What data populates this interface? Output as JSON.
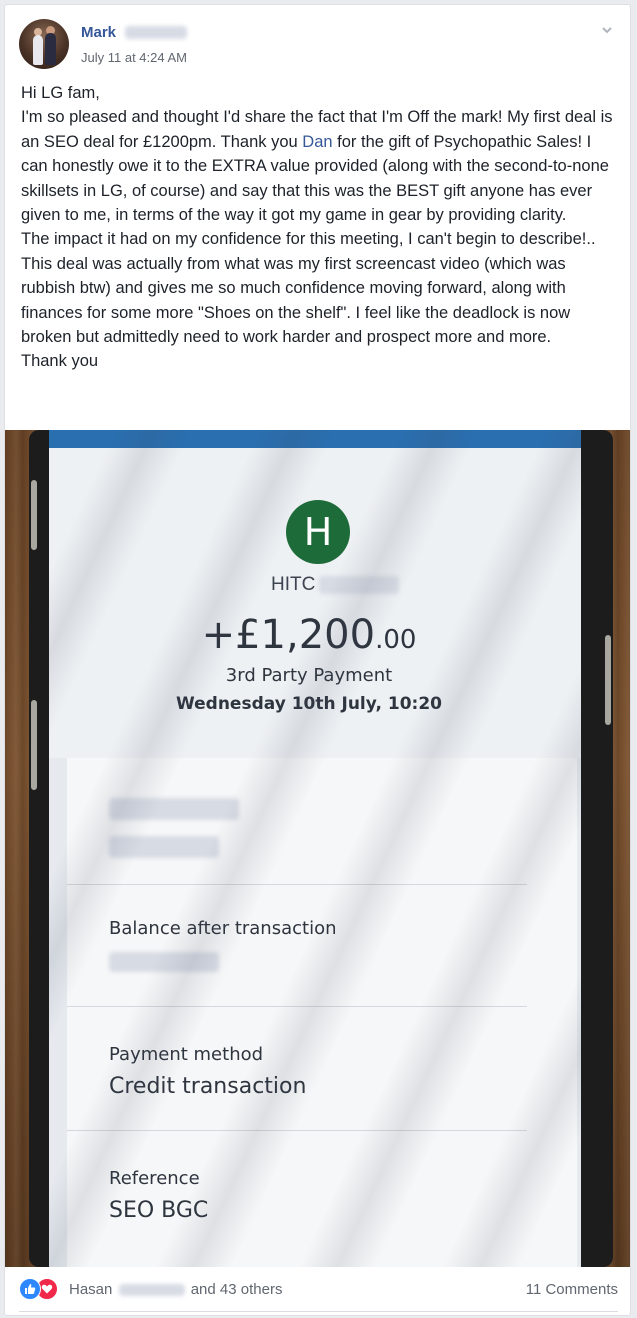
{
  "post": {
    "author_first_name": "Mark",
    "timestamp": "July 11 at 4:24 AM",
    "body": {
      "p1": "Hi LG fam,",
      "p2_before_mention": "I'm so pleased and thought I'd share the fact that I'm Off the mark! My first deal is an SEO deal for £1200pm. Thank you ",
      "p2_mention": "Dan",
      "p2_after_mention": " for the gift of Psychopathic Sales! I can honestly owe it to the EXTRA value provided (along with the second-to-none skillsets in LG, of course) and say that this was the BEST gift anyone has ever given to me, in terms of the way it got my game in gear by providing clarity.",
      "p3": "The impact it had on my confidence for this meeting, I can't begin to describe!.. This deal was actually from what was my first screencast video (which was rubbish btw) and gives me so much confidence moving forward, along with finances for some more \"Shoes on the shelf\". I feel like the deadlock is now broken but admittedly need to work harder and prospect more and more.",
      "p4": "Thank you"
    }
  },
  "bank_screen": {
    "logo_letter": "H",
    "payee_visible": "HITC",
    "amount_main": "+£1,200",
    "amount_pence": ".00",
    "payment_type": "3rd Party Payment",
    "date": "Wednesday 10th July, 10:20",
    "balance_label": "Balance after transaction",
    "method_label": "Payment method",
    "method_value": "Credit transaction",
    "reference_label": "Reference",
    "reference_value": "SEO BGC"
  },
  "footer": {
    "reactor_first_name": "Hasan",
    "others_text": "and 43 others",
    "comments_text": "11 Comments"
  },
  "icons": {
    "like": "like-icon",
    "love": "love-icon",
    "menu": "chevron-down-icon"
  },
  "colors": {
    "link": "#365899",
    "bank_green": "#1e6b3a",
    "like_blue": "#2d88ff",
    "love_red": "#f0284a"
  }
}
